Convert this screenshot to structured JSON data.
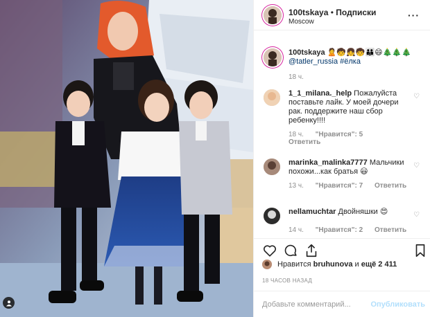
{
  "post": {
    "author": "100tskaya",
    "follow_label": "Подписки",
    "location": "Moscow"
  },
  "caption": {
    "author": "100tskaya",
    "emojis": "🙎🧒👧🧒👪😄🎄🎄🎄",
    "tags": "@tatler_russia #ёлка",
    "time": "18 ч."
  },
  "comments": [
    {
      "author": "1_1_milana._help",
      "text": "Пожалуйста поставьте лайк. У моей дочери рак. поддержите наш сбор ребенку!!!!",
      "time": "18 ч.",
      "likes": "\"Нравится\": 5",
      "reply": "Ответить"
    },
    {
      "author": "marinka_malinka7777",
      "text": "Мальчики похожи...как братья 😃",
      "time": "13 ч.",
      "likes": "\"Нравится\": 7",
      "reply": "Ответить"
    },
    {
      "author": "nellamuchtar",
      "text": "Двойняшки 😍",
      "time": "14 ч.",
      "likes": "\"Нравится\": 2",
      "reply": "Ответить"
    }
  ],
  "likes": {
    "prefix": "Нравится",
    "user": "bruhunova",
    "and": "и",
    "more": "ещё 2 411"
  },
  "timestamp": "18 ЧАСОВ НАЗАД",
  "add_comment": {
    "placeholder": "Добавьте комментарий...",
    "publish": "Опубликовать"
  },
  "icons": {
    "more": "more-icon",
    "heart": "heart-icon",
    "comment": "comment-icon",
    "share": "share-icon",
    "save": "bookmark-icon",
    "user_tag": "person-icon"
  },
  "colors": {
    "link": "#003569",
    "muted": "#8e8e8e",
    "publish_disabled": "#b2dffc",
    "border": "#efefef"
  }
}
